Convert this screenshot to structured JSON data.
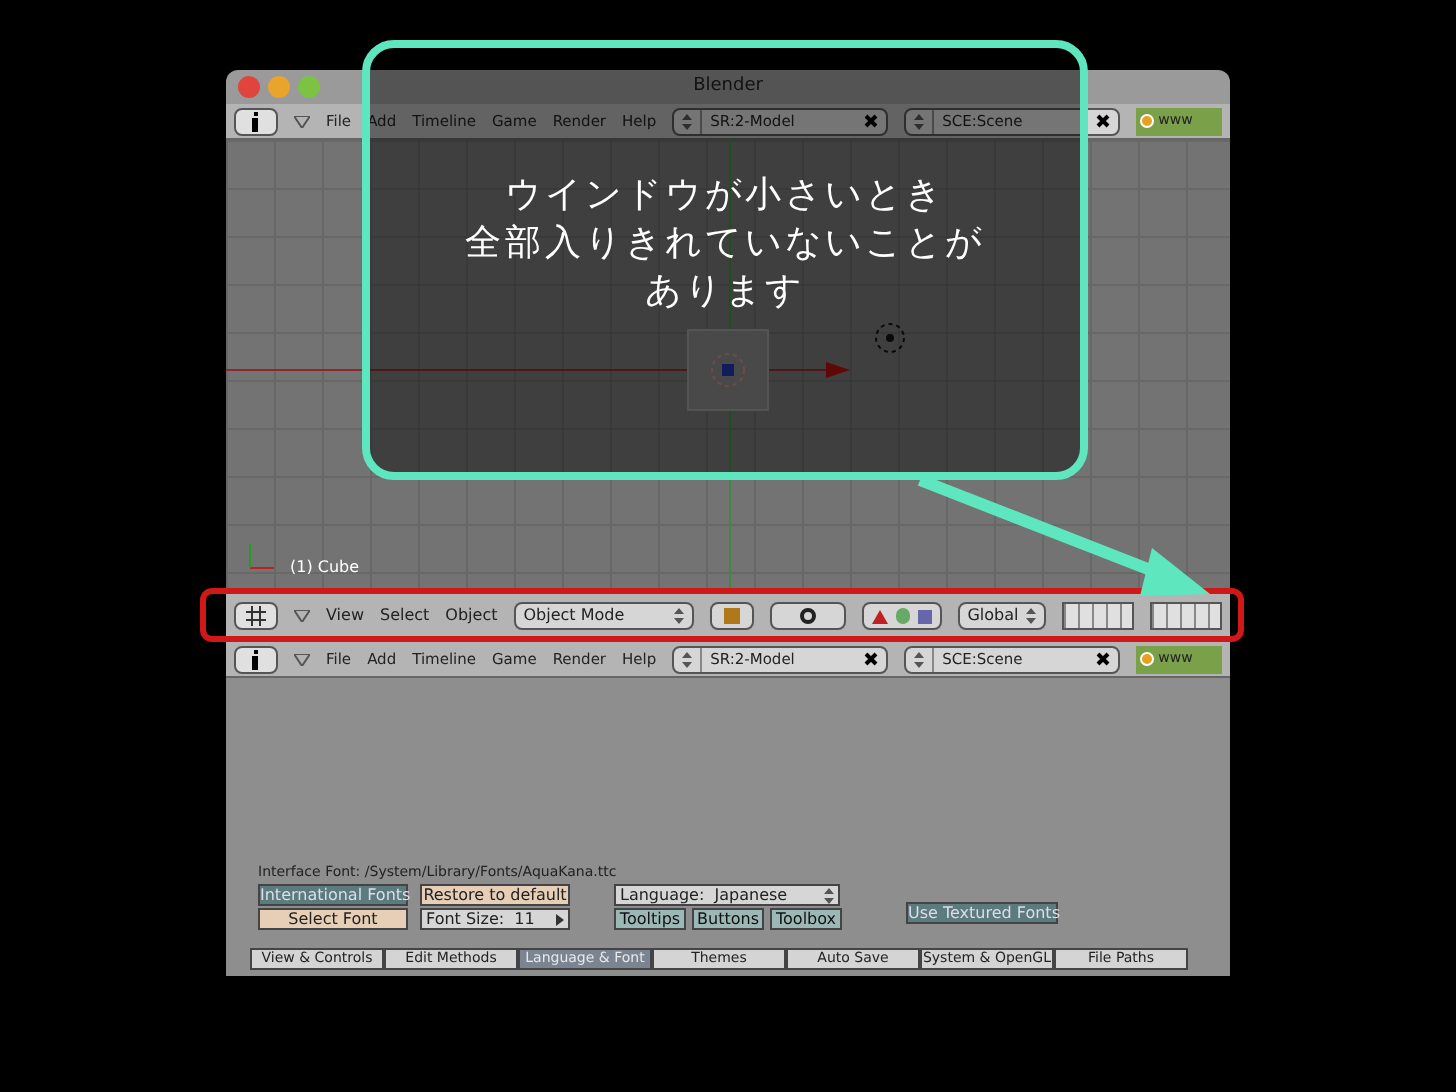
{
  "window": {
    "title": "Blender"
  },
  "top_header": {
    "menu": [
      "File",
      "Add",
      "Timeline",
      "Game",
      "Render",
      "Help"
    ],
    "screen": "SR:2-Model",
    "scene": "SCE:Scene",
    "extra": "www"
  },
  "viewport": {
    "object_label": "(1) Cube"
  },
  "view3d_header": {
    "menu": [
      "View",
      "Select",
      "Object"
    ],
    "mode": "Object Mode",
    "orientation": "Global"
  },
  "info_header": {
    "menu": [
      "File",
      "Add",
      "Timeline",
      "Game",
      "Render",
      "Help"
    ],
    "screen": "SR:2-Model",
    "scene": "SCE:Scene",
    "extra": "www"
  },
  "preferences": {
    "interface_font": "Interface Font: /System/Library/Fonts/AquaKana.ttc",
    "international_fonts": {
      "label": "International Fonts",
      "on": true
    },
    "restore_default": "Restore to default",
    "select_font": "Select Font",
    "font_size": "Font Size:  11",
    "language": "Language:  Japanese",
    "ui_toggles": [
      {
        "label": "Tooltips",
        "on": true
      },
      {
        "label": "Buttons",
        "on": true
      },
      {
        "label": "Toolbox",
        "on": true
      }
    ],
    "textured_fonts": {
      "label": "Use Textured Fonts",
      "on": true
    },
    "tabs": [
      {
        "label": "View & Controls",
        "selected": false
      },
      {
        "label": "Edit Methods",
        "selected": false
      },
      {
        "label": "Language & Font",
        "selected": true
      },
      {
        "label": "Themes",
        "selected": false
      },
      {
        "label": "Auto Save",
        "selected": false
      },
      {
        "label": "System & OpenGL",
        "selected": false
      },
      {
        "label": "File Paths",
        "selected": false
      }
    ]
  },
  "callout": {
    "lines": [
      "ウインドウが小さいとき",
      "全部入りきれていないことが",
      "あります"
    ]
  }
}
